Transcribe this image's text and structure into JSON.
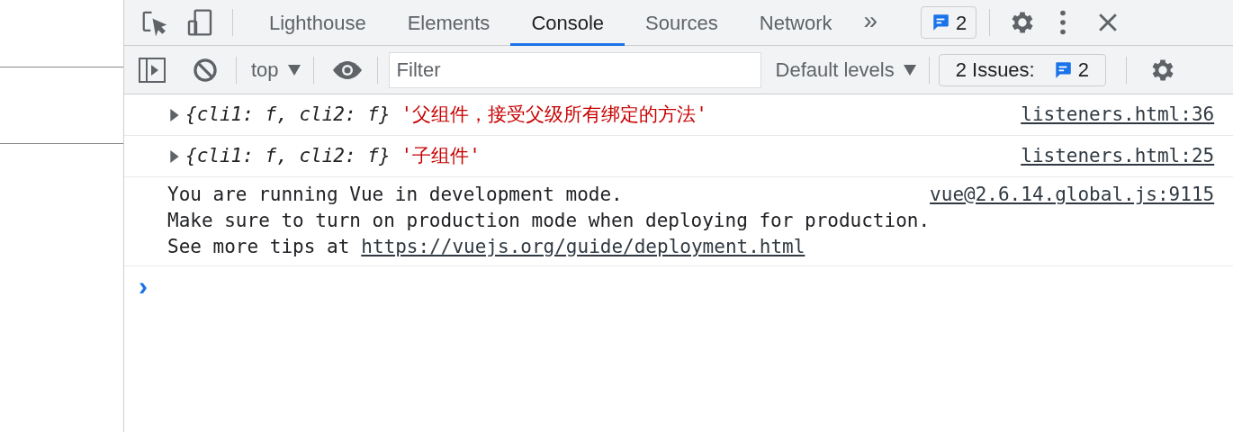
{
  "tabs": [
    {
      "label": "Lighthouse",
      "selected": false
    },
    {
      "label": "Elements",
      "selected": false
    },
    {
      "label": "Console",
      "selected": true
    },
    {
      "label": "Sources",
      "selected": false
    },
    {
      "label": "Network",
      "selected": false
    }
  ],
  "more_tabs": "»",
  "messages_badge": "2",
  "toolbar": {
    "context": "top",
    "filter_placeholder": "Filter",
    "levels": "Default levels",
    "issues_label": "2 Issues:",
    "issues_count": "2"
  },
  "messages": [
    {
      "kind": "object",
      "preview": "{cli1: f, cli2: f}",
      "string": "'父组件，接受父级所有绑定的方法'",
      "source": "listeners.html:36"
    },
    {
      "kind": "object",
      "preview": "{cli1: f, cli2: f}",
      "string": "'子组件'",
      "source": "listeners.html:25"
    },
    {
      "kind": "text",
      "lines": [
        "You are running Vue in development mode.",
        "Make sure to turn on production mode when deploying for production."
      ],
      "prefix": "See more tips at",
      "link": "https://vuejs.org/guide/deployment.html",
      "source": "vue@2.6.14.global.js:9115"
    }
  ],
  "prompt": "›"
}
